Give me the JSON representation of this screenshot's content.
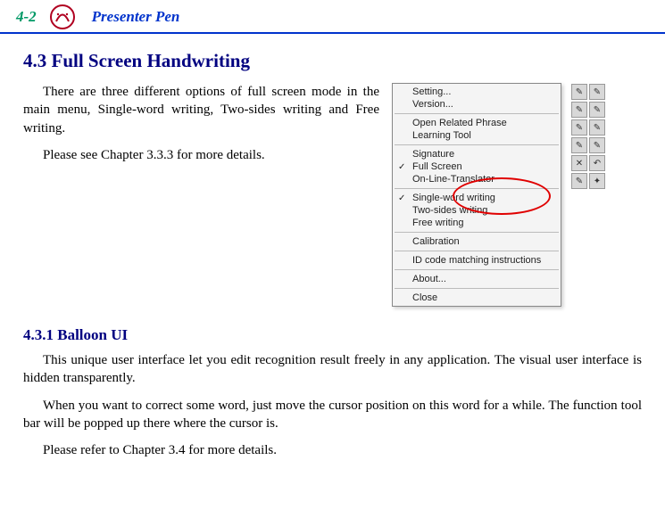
{
  "header": {
    "page_number": "4-2",
    "title": "Presenter Pen"
  },
  "section_4_3": {
    "title": "4.3 Full Screen Handwriting",
    "p1": "There are three different options of full screen mode in the main menu, Single-word writing, Two-sides writing and Free writing.",
    "p2": "Please see Chapter 3.3.3 for more details."
  },
  "menu": {
    "items": [
      {
        "label": "Setting...",
        "group": 0
      },
      {
        "label": "Version...",
        "group": 0
      },
      {
        "label": "Open Related Phrase",
        "group": 1
      },
      {
        "label": "Learning Tool",
        "group": 1
      },
      {
        "label": "Signature",
        "group": 2
      },
      {
        "label": "Full Screen",
        "group": 2,
        "checked": true
      },
      {
        "label": "On-Line-Translator",
        "group": 2
      },
      {
        "label": "Single-word writing",
        "group": 3,
        "checked": true
      },
      {
        "label": "Two-sides writing",
        "group": 3
      },
      {
        "label": "Free writing",
        "group": 3
      },
      {
        "label": "Calibration",
        "group": 4
      },
      {
        "label": "ID code matching instructions",
        "group": 5
      },
      {
        "label": "About...",
        "group": 6
      },
      {
        "label": "Close",
        "group": 7
      }
    ],
    "highlighted_group": 3,
    "toolbar_icons": [
      "pen-icon",
      "pen-icon",
      "pen-icon",
      "pen-icon",
      "pen-icon",
      "pen-icon",
      "pen-icon",
      "pen-icon",
      "close-icon",
      "undo-icon",
      "brush-icon",
      "wand-icon"
    ]
  },
  "section_4_3_1": {
    "title": "4.3.1 Balloon UI",
    "p1": "This unique user interface let you edit recognition result freely in any application. The visual user interface is hidden transparently.",
    "p2": "When you want to correct some word, just move the cursor position on this word for a while. The function tool bar will be popped up there where the cursor is.",
    "p3": "Please refer to Chapter 3.4 for more details."
  }
}
